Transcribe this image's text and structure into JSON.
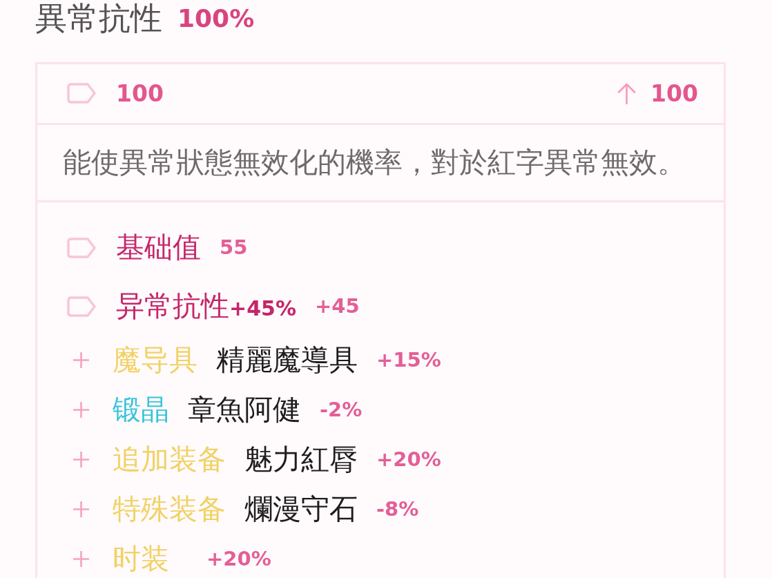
{
  "title": {
    "label": "異常抗性",
    "value": "100%"
  },
  "summary": {
    "value": "100",
    "total": "100"
  },
  "description": "能使異常狀態無效化的機率，對於紅字異常無效。",
  "breakdown": [
    {
      "label": "基础值",
      "value": "55"
    },
    {
      "label": "异常抗性**+45%**",
      "value": "+45"
    }
  ],
  "sources": [
    {
      "category": "魔导具",
      "color": "#f0d264",
      "item": "精麗魔導具",
      "bonus": "+15%"
    },
    {
      "category": "锻晶",
      "color": "#38c4da",
      "item": "章魚阿健",
      "bonus": "-2%"
    },
    {
      "category": "追加装备",
      "color": "#f0d264",
      "item": "魅力紅脣",
      "bonus": "+20%"
    },
    {
      "category": "特殊装备",
      "color": "#f0d264",
      "item": "爛漫守石",
      "bonus": "-8%"
    },
    {
      "category": "时装",
      "color": "#f0d264",
      "bonus": "+20%"
    }
  ]
}
